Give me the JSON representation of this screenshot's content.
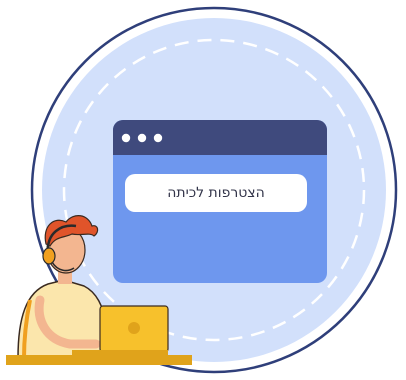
{
  "window": {
    "dots_icon": "three-dots-icon",
    "button_label": "הצטרפות לכיתה"
  },
  "colors": {
    "outer_circle_stroke": "#2f3f7a",
    "inner_circle_fill": "#d2e0fb",
    "dashed_ring": "#ffffff",
    "window_titlebar": "#3f4a7d",
    "window_body": "#6e97ee",
    "button_bg": "#ffffff",
    "button_text": "#33354a",
    "desk": "#e0a31b",
    "laptop": "#f7c12c",
    "shirt": "#fbe6ac",
    "hair": "#e0542a",
    "skin": "#f3b690",
    "headset": "#f0a020"
  }
}
